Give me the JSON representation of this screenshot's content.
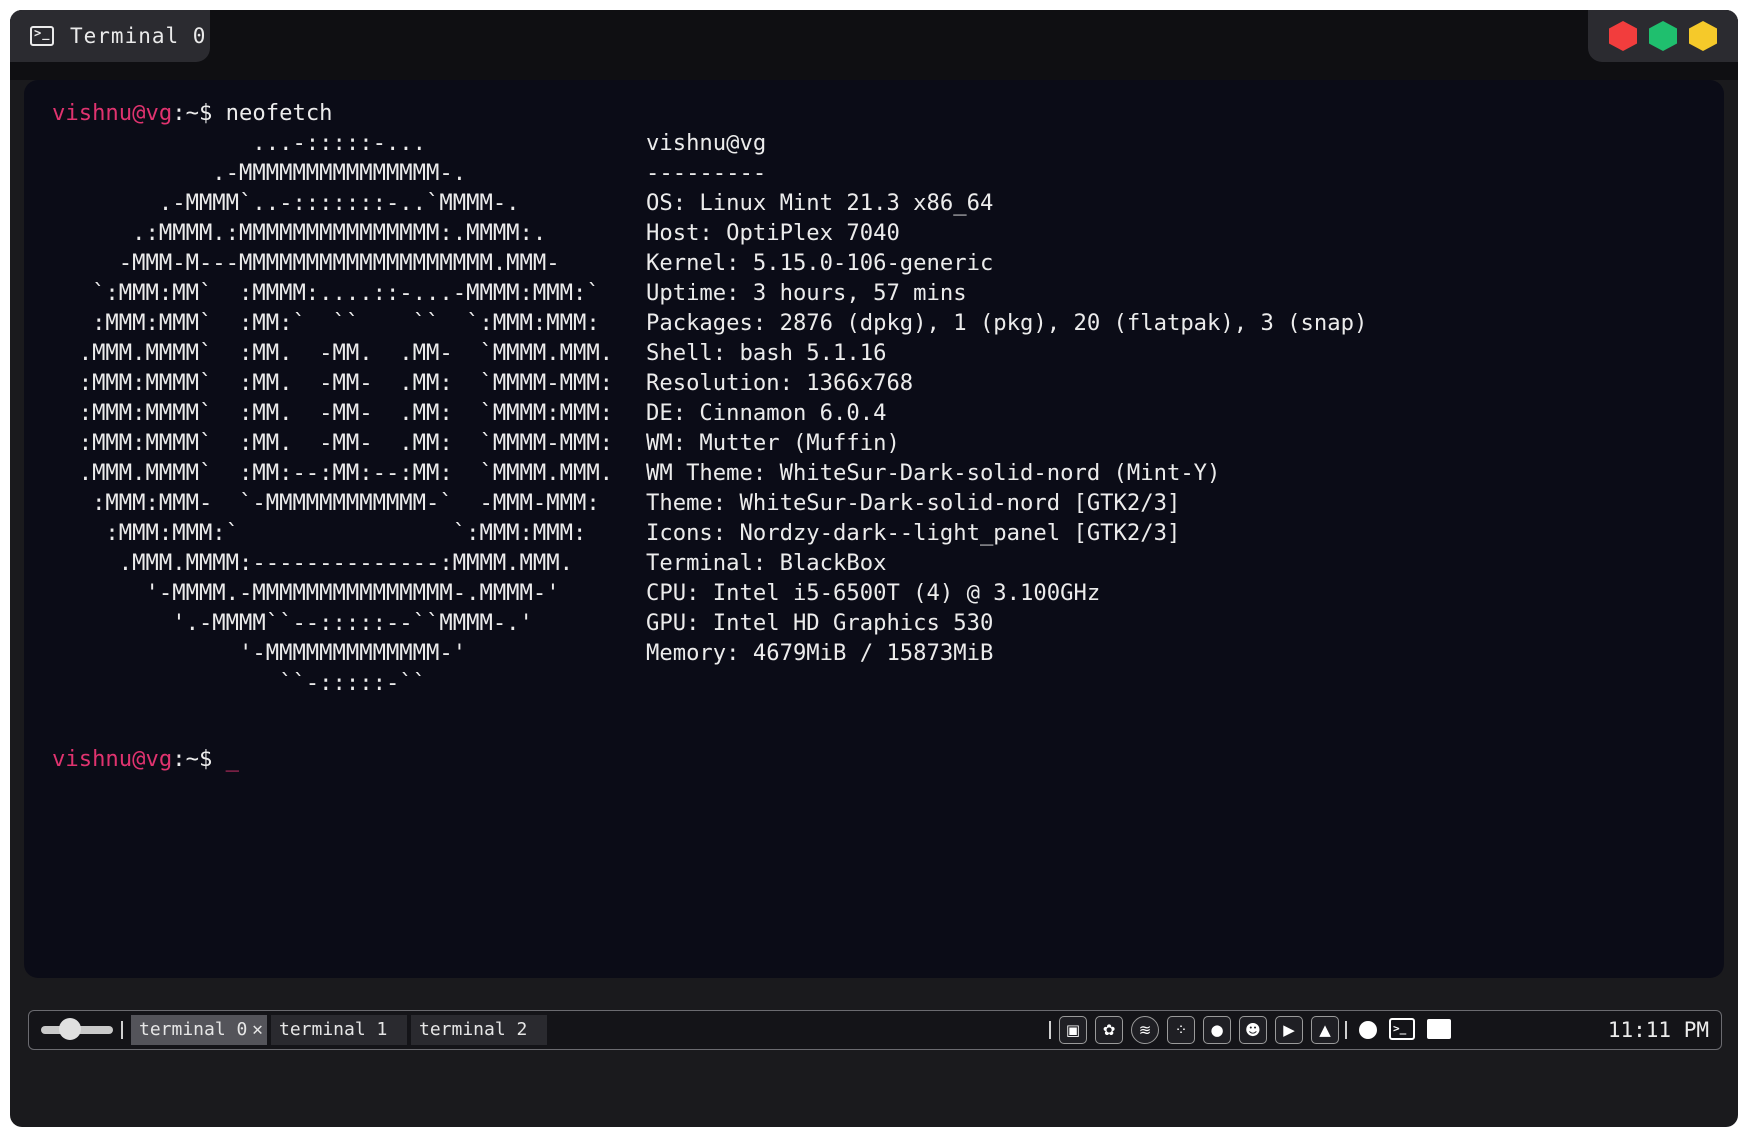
{
  "window": {
    "title": "Terminal 0",
    "controls": [
      {
        "name": "close",
        "color": "#f23d3d"
      },
      {
        "name": "maximize",
        "color": "#1fbf6e"
      },
      {
        "name": "minimize",
        "color": "#f5c92a"
      }
    ]
  },
  "terminal": {
    "user": "vishnu@vg",
    "prompt_suffix": ":~$ ",
    "command": "neofetch",
    "cursor": "_",
    "logo": "               ...-:::::-...\n            .-MMMMMMMMMMMMMMM-.\n        .-MMMM`..-:::::::-..`MMMM-.\n      .:MMMM.:MMMMMMMMMMMMMMM:.MMMM:.\n     -MMM-M---MMMMMMMMMMMMMMMMMMM.MMM-\n   `:MMM:MM`  :MMMM:....::-...-MMMM:MMM:`\n   :MMM:MMM`  :MM:`  ``    ``  `:MMM:MMM:\n  .MMM.MMMM`  :MM.  -MM.  .MM-  `MMMM.MMM.\n  :MMM:MMMM`  :MM.  -MM-  .MM:  `MMMM-MMM:\n  :MMM:MMMM`  :MM.  -MM-  .MM:  `MMMM:MMM:\n  :MMM:MMMM`  :MM.  -MM-  .MM:  `MMMM-MMM:\n  .MMM.MMMM`  :MM:--:MM:--:MM:  `MMMM.MMM.\n   :MMM:MMM-  `-MMMMMMMMMMMM-`  -MMM-MMM:\n    :MMM:MMM:`                `:MMM:MMM:\n     .MMM.MMMM:--------------:MMMM.MMM.\n       '-MMMM.-MMMMMMMMMMMMMMM-.MMMM-'\n         '.-MMMM``--:::::--``MMMM-.'\n              '-MMMMMMMMMMMMM-'\n                 ``-:::::-``",
    "info_header": "vishnu@vg",
    "info_rule": "---------",
    "info": [
      "OS: Linux Mint 21.3 x86_64",
      "Host: OptiPlex 7040",
      "Kernel: 5.15.0-106-generic",
      "Uptime: 3 hours, 57 mins",
      "Packages: 2876 (dpkg), 1 (pkg), 20 (flatpak), 3 (snap)",
      "Shell: bash 5.1.16",
      "Resolution: 1366x768",
      "DE: Cinnamon 6.0.4",
      "WM: Mutter (Muffin)",
      "WM Theme: WhiteSur-Dark-solid-nord (Mint-Y)",
      "Theme: WhiteSur-Dark-solid-nord [GTK2/3]",
      "Icons: Nordzy-dark--light_panel [GTK2/3]",
      "Terminal: BlackBox",
      "CPU: Intel i5-6500T (4) @ 3.100GHz",
      "GPU: Intel HD Graphics 530",
      "Memory: 4679MiB / 15873MiB"
    ]
  },
  "panel": {
    "tabs": [
      "terminal 0",
      "terminal 1",
      "terminal 2"
    ],
    "close_glyph": "✕",
    "tray_icons": [
      "screen-recorder-icon",
      "chatgpt-icon",
      "spotify-icon",
      "figma-icon",
      "github-icon",
      "discord-icon",
      "youtube-icon",
      "drive-icon"
    ],
    "clock": "11:11 PM"
  },
  "colors": {
    "prompt_user": "#e0336f",
    "terminal_bg": "#0b0c17",
    "text": "#ececec"
  }
}
